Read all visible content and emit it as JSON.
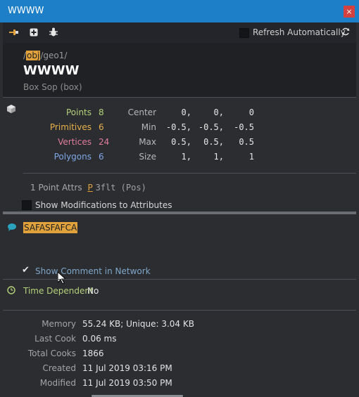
{
  "window": {
    "title": "WWWW",
    "close_glyph": "×"
  },
  "toolbar": {
    "refresh_label": "Refresh Automatically",
    "icons": [
      "pin-icon",
      "add-icon",
      "bug-icon",
      "refresh-icon"
    ]
  },
  "node": {
    "path_prefix": "/",
    "path_obj": "obj",
    "path_rest": "/geo1/",
    "name": "WWWW",
    "type": "Box Sop (box)"
  },
  "counts": {
    "points": {
      "label": "Points",
      "value": "8",
      "color": "#b5d17a"
    },
    "primitives": {
      "label": "Primitives",
      "value": "6",
      "color": "#e8b04b"
    },
    "vertices": {
      "label": "Vertices",
      "value": "24",
      "color": "#e17c9a"
    },
    "polygons": {
      "label": "Polygons",
      "value": "6",
      "color": "#7fa6e6"
    }
  },
  "bounds": {
    "center": {
      "label": "Center",
      "x": "0,",
      "y": "0,",
      "z": "0"
    },
    "min": {
      "label": "Min",
      "x": "-0.5,",
      "y": "-0.5,",
      "z": "-0.5"
    },
    "max": {
      "label": "Max",
      "x": "0.5,",
      "y": "0.5,",
      "z": "0.5"
    },
    "size": {
      "label": "Size",
      "x": "1,",
      "y": "1,",
      "z": "1"
    }
  },
  "attributes": {
    "summary": "1 Point Attrs",
    "attr_name": "P",
    "attr_detail": "3flt (Pos)"
  },
  "show_mods_label": "Show Modifications to Attributes",
  "comment": {
    "text": "SAFASFAFCA",
    "show_label": "Show Comment in Network"
  },
  "time_dependent": {
    "label": "Time Dependent",
    "value": "No"
  },
  "info": [
    {
      "label": "Memory",
      "value": "55.24 KB; Unique: 3.04 KB"
    },
    {
      "label": "Last Cook",
      "value": "0.06 ms"
    },
    {
      "label": "Total Cooks",
      "value": "1866"
    },
    {
      "label": "Created",
      "value": "11 Jul 2019 03:16 PM"
    },
    {
      "label": "Modified",
      "value": "11 Jul 2019 03:50 PM"
    }
  ]
}
